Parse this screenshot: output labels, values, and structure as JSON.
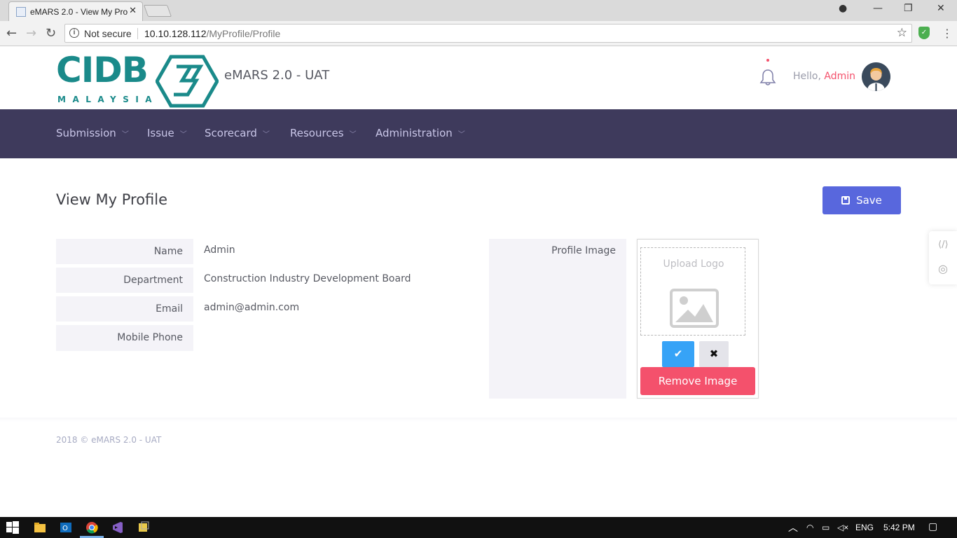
{
  "browser": {
    "tab_title": "eMARS 2.0 - View My Pro",
    "security_label": "Not secure",
    "url_host": "10.10.128.112",
    "url_path": "/MyProfile/Profile"
  },
  "header": {
    "logo_text": "CIDB",
    "logo_sub": "MALAYSIA",
    "app_name": "eMARS 2.0 - UAT",
    "greeting": "Hello,",
    "user_name": "Admin"
  },
  "nav": {
    "items": [
      {
        "label": "Submission"
      },
      {
        "label": "Issue"
      },
      {
        "label": "Scorecard"
      },
      {
        "label": "Resources"
      },
      {
        "label": "Administration"
      }
    ]
  },
  "page": {
    "title": "View My Profile",
    "save_label": "Save"
  },
  "profile": {
    "fields": [
      {
        "label": "Name",
        "value": "Admin"
      },
      {
        "label": "Department",
        "value": "Construction Industry Development Board"
      },
      {
        "label": "Email",
        "value": "admin@admin.com"
      },
      {
        "label": "Mobile Phone",
        "value": ""
      }
    ],
    "image_label": "Profile Image",
    "upload_text": "Upload Logo",
    "remove_label": "Remove Image"
  },
  "footer": {
    "text": "2018 © eMARS 2.0 - UAT"
  },
  "taskbar": {
    "language": "ENG",
    "time": "5:42 PM"
  },
  "colors": {
    "navbar": "#3e3a5c",
    "brand_teal": "#1a8a8a",
    "primary": "#5867dd",
    "danger": "#f4516c",
    "info": "#36a3f7"
  }
}
